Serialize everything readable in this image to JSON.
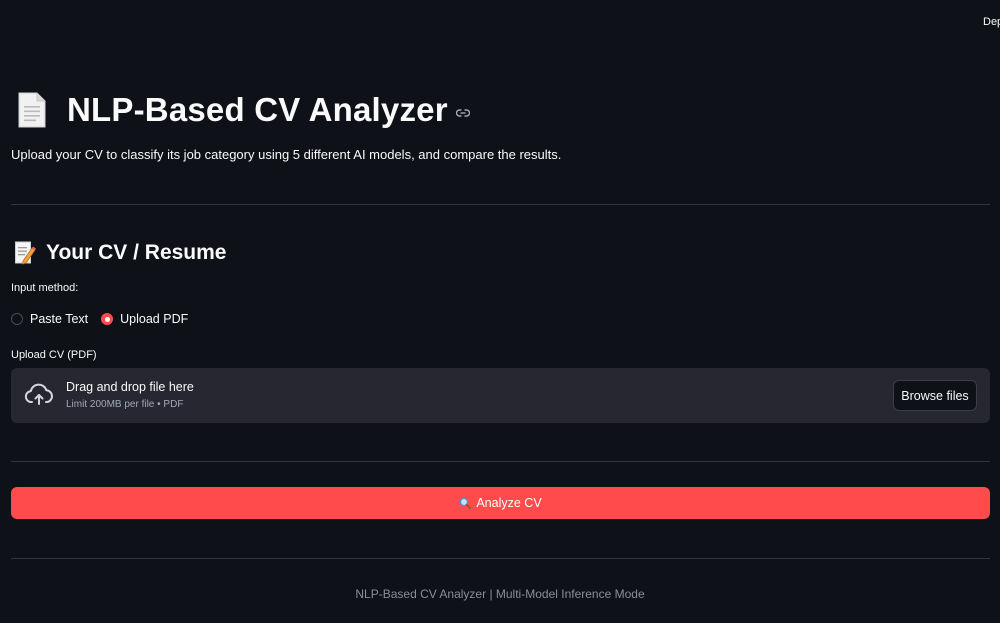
{
  "header": {
    "deploy_label": "Deploy"
  },
  "app": {
    "title": "NLP-Based CV Analyzer",
    "subtitle": "Upload your CV to classify its job category using 5 different AI models, and compare the results."
  },
  "cv_section": {
    "title": "Your CV / Resume",
    "input_method_label": "Input method:",
    "options": [
      "Paste Text",
      "Upload PDF"
    ],
    "selected_option": "Upload PDF",
    "upload_label": "Upload CV (PDF)",
    "dropzone": {
      "main_text": "Drag and drop file here",
      "sub_text": "Limit 200MB per file • PDF",
      "browse_label": "Browse files"
    }
  },
  "actions": {
    "analyze_label": "Analyze CV"
  },
  "footer": {
    "text": "NLP-Based CV Analyzer | Multi-Model Inference Mode"
  },
  "colors": {
    "background": "#0e1117",
    "accent": "#ff4b4b",
    "dropzone": "#262730",
    "divider": "#31333f"
  },
  "icons": {
    "title": "page-document-icon",
    "anchor": "link-icon",
    "section": "memo-pencil-icon",
    "upload": "cloud-upload-icon",
    "analyze": "magnifying-glass-icon"
  }
}
